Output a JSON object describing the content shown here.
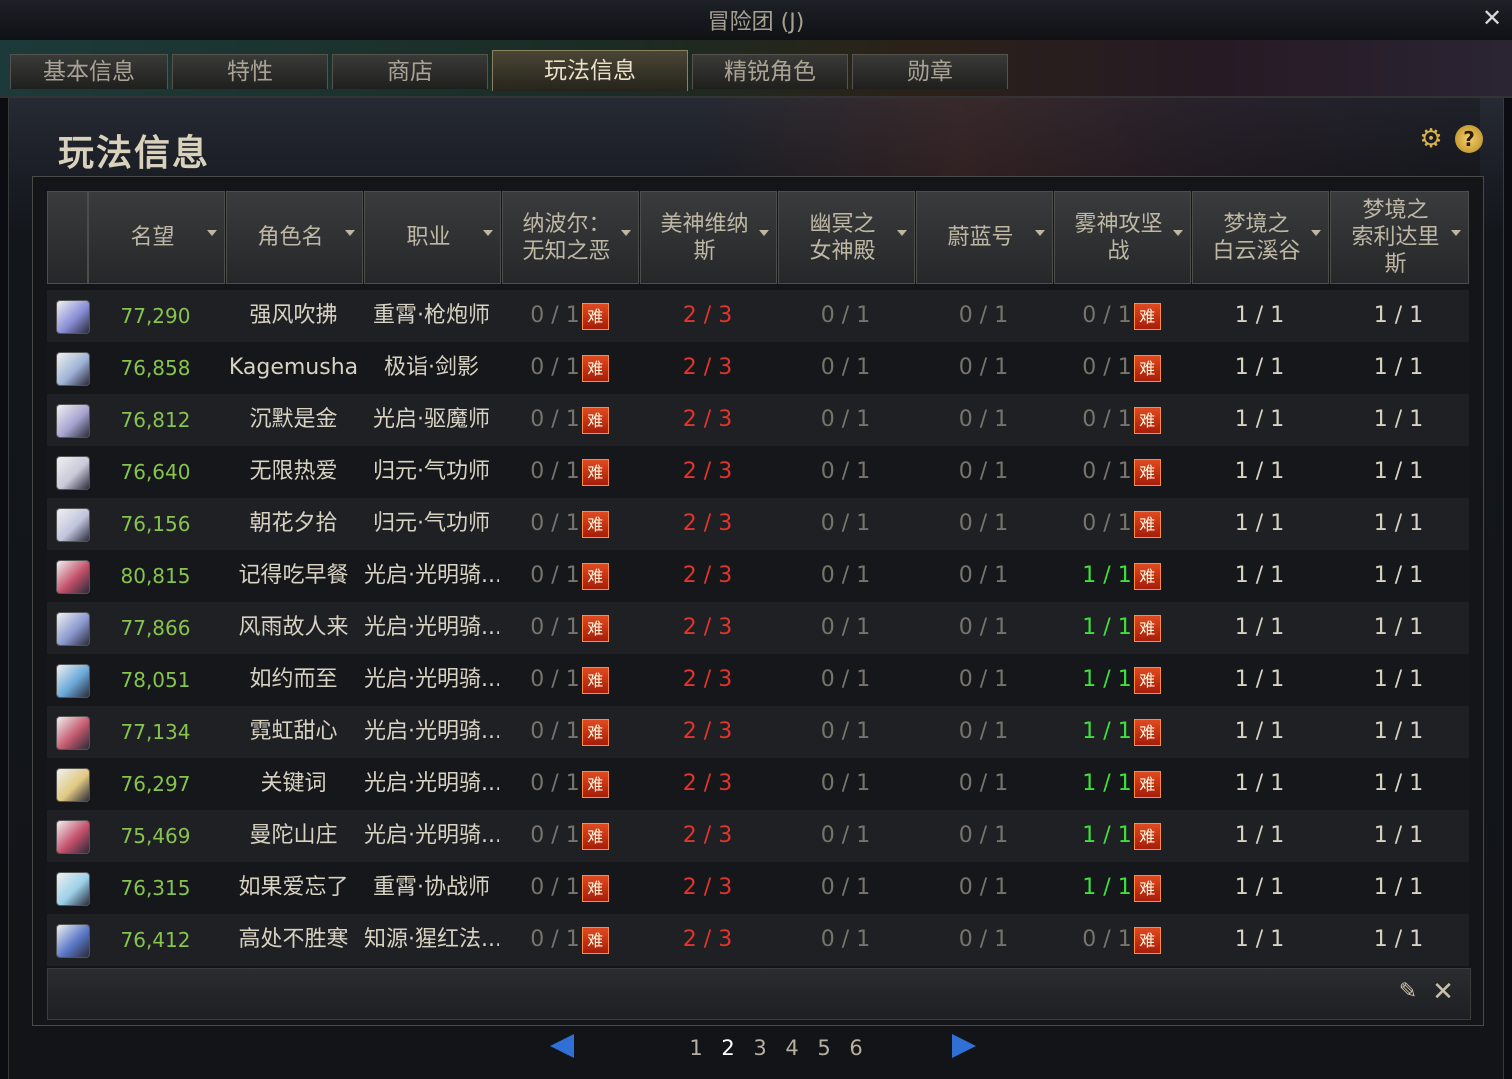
{
  "window": {
    "title": "冒险团 (J)"
  },
  "tabs": [
    {
      "label": "基本信息"
    },
    {
      "label": "特性"
    },
    {
      "label": "商店"
    },
    {
      "label": "玩法信息",
      "active": true
    },
    {
      "label": "精锐角色"
    },
    {
      "label": "勋章"
    }
  ],
  "page": {
    "heading": "玩法信息"
  },
  "icons": {
    "settings": "gear-icon",
    "help": "help-icon",
    "edit": "pencil-icon",
    "close": "close-icon"
  },
  "table": {
    "headers": [
      {
        "key": "avatar",
        "label": ""
      },
      {
        "key": "fame",
        "label": "名望"
      },
      {
        "key": "name",
        "label": "角色名"
      },
      {
        "key": "job",
        "label": "职业"
      },
      {
        "key": "d1",
        "label": "纳波尔：\n无知之恶"
      },
      {
        "key": "d2",
        "label": "美神维纳\n斯"
      },
      {
        "key": "d3",
        "label": "幽冥之\n女神殿"
      },
      {
        "key": "d4",
        "label": "蔚蓝号"
      },
      {
        "key": "d5",
        "label": "雾神攻坚\n战"
      },
      {
        "key": "d6",
        "label": "梦境之\n白云溪谷"
      },
      {
        "key": "d7",
        "label": "梦境之\n索利达里\n斯"
      }
    ],
    "hard_badge": "难",
    "rows": [
      {
        "fame": "77,290",
        "name": "强风吹拂",
        "job": "重霄·枪炮师",
        "d1": "0 / 1",
        "d2": "2 / 3",
        "d3": "0 / 1",
        "d4": "0 / 1",
        "d5": "0 / 1",
        "d5_done": false,
        "d6": "1 / 1",
        "d7": "1 / 1",
        "avatar_color": "#8a8fd8"
      },
      {
        "fame": "76,858",
        "name": "Kagemusha",
        "job": "极诣·剑影",
        "d1": "0 / 1",
        "d2": "2 / 3",
        "d3": "0 / 1",
        "d4": "0 / 1",
        "d5": "0 / 1",
        "d5_done": false,
        "d6": "1 / 1",
        "d7": "1 / 1",
        "avatar_color": "#9fb3d6"
      },
      {
        "fame": "76,812",
        "name": "沉默是金",
        "job": "光启·驱魔师",
        "d1": "0 / 1",
        "d2": "2 / 3",
        "d3": "0 / 1",
        "d4": "0 / 1",
        "d5": "0 / 1",
        "d5_done": false,
        "d6": "1 / 1",
        "d7": "1 / 1",
        "avatar_color": "#a7a4d0"
      },
      {
        "fame": "76,640",
        "name": "无限热爱",
        "job": "归元·气功师",
        "d1": "0 / 1",
        "d2": "2 / 3",
        "d3": "0 / 1",
        "d4": "0 / 1",
        "d5": "0 / 1",
        "d5_done": false,
        "d6": "1 / 1",
        "d7": "1 / 1",
        "avatar_color": "#c8c8d8"
      },
      {
        "fame": "76,156",
        "name": "朝花夕拾",
        "job": "归元·气功师",
        "d1": "0 / 1",
        "d2": "2 / 3",
        "d3": "0 / 1",
        "d4": "0 / 1",
        "d5": "0 / 1",
        "d5_done": false,
        "d6": "1 / 1",
        "d7": "1 / 1",
        "avatar_color": "#c0c4dc"
      },
      {
        "fame": "80,815",
        "name": "记得吃早餐",
        "job": "光启·光明骑...",
        "d1": "0 / 1",
        "d2": "2 / 3",
        "d3": "0 / 1",
        "d4": "0 / 1",
        "d5": "1 / 1",
        "d5_done": true,
        "d6": "1 / 1",
        "d7": "1 / 1",
        "avatar_color": "#c2506a"
      },
      {
        "fame": "77,866",
        "name": "风雨故人来",
        "job": "光启·光明骑...",
        "d1": "0 / 1",
        "d2": "2 / 3",
        "d3": "0 / 1",
        "d4": "0 / 1",
        "d5": "1 / 1",
        "d5_done": true,
        "d6": "1 / 1",
        "d7": "1 / 1",
        "avatar_color": "#8b9ad0"
      },
      {
        "fame": "78,051",
        "name": "如约而至",
        "job": "光启·光明骑...",
        "d1": "0 / 1",
        "d2": "2 / 3",
        "d3": "0 / 1",
        "d4": "0 / 1",
        "d5": "1 / 1",
        "d5_done": true,
        "d6": "1 / 1",
        "d7": "1 / 1",
        "avatar_color": "#6aa8d8"
      },
      {
        "fame": "77,134",
        "name": "霓虹甜心",
        "job": "光启·光明骑...",
        "d1": "0 / 1",
        "d2": "2 / 3",
        "d3": "0 / 1",
        "d4": "0 / 1",
        "d5": "1 / 1",
        "d5_done": true,
        "d6": "1 / 1",
        "d7": "1 / 1",
        "avatar_color": "#c45a6e"
      },
      {
        "fame": "76,297",
        "name": "关键词",
        "job": "光启·光明骑...",
        "d1": "0 / 1",
        "d2": "2 / 3",
        "d3": "0 / 1",
        "d4": "0 / 1",
        "d5": "1 / 1",
        "d5_done": true,
        "d6": "1 / 1",
        "d7": "1 / 1",
        "avatar_color": "#e0c880"
      },
      {
        "fame": "75,469",
        "name": "曼陀山庄",
        "job": "光启·光明骑...",
        "d1": "0 / 1",
        "d2": "2 / 3",
        "d3": "0 / 1",
        "d4": "0 / 1",
        "d5": "1 / 1",
        "d5_done": true,
        "d6": "1 / 1",
        "d7": "1 / 1",
        "avatar_color": "#c4506c"
      },
      {
        "fame": "76,315",
        "name": "如果爱忘了",
        "job": "重霄·协战师",
        "d1": "0 / 1",
        "d2": "2 / 3",
        "d3": "0 / 1",
        "d4": "0 / 1",
        "d5": "1 / 1",
        "d5_done": true,
        "d6": "1 / 1",
        "d7": "1 / 1",
        "avatar_color": "#9ad0e8"
      },
      {
        "fame": "76,412",
        "name": "高处不胜寒",
        "job": "知源·猩红法...",
        "d1": "0 / 1",
        "d2": "2 / 3",
        "d3": "0 / 1",
        "d4": "0 / 1",
        "d5": "0 / 1",
        "d5_done": false,
        "d6": "1 / 1",
        "d7": "1 / 1",
        "avatar_color": "#5a78c8"
      }
    ]
  },
  "pagination": {
    "pages": [
      "1",
      "2",
      "3",
      "4",
      "5",
      "6"
    ],
    "current": "2"
  },
  "colors": {
    "fame": "#86c44e",
    "incomplete": "#77746c",
    "partial": "#e0352d",
    "complete_green": "#3ee03c",
    "badge": "#c8321a",
    "pager_arrow": "#2f6fd6"
  }
}
